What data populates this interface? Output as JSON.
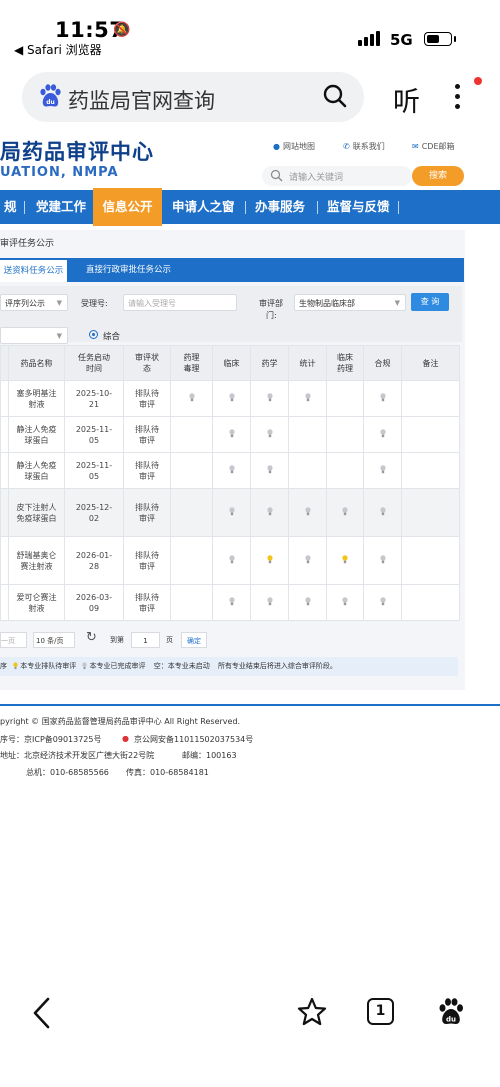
{
  "status_bar": {
    "time": "11:57",
    "back_app": "◀ Safari 浏览器",
    "network": "5G"
  },
  "browser": {
    "search_query": "药监局官网查询",
    "listen_label": "听"
  },
  "site": {
    "title": "局药品审评中心",
    "subtitle": "UATION, NMPA",
    "top_links": [
      "网站地图",
      "联系我们",
      "CDE邮箱"
    ],
    "search_placeholder": "请输入关键词",
    "search_button": "搜索"
  },
  "nav": {
    "items": [
      "规",
      "党建工作",
      "信息公开",
      "申请人之窗",
      "办事服务",
      "监督与反馈"
    ],
    "active": "信息公开"
  },
  "panel": {
    "title": "审评任务公示",
    "tabs": [
      "送资料任务公示",
      "直接行政审批任务公示"
    ],
    "filters": {
      "sequence_value": "评序列公示",
      "accept_no_label": "受理号:",
      "accept_no_placeholder": "请输入受理号",
      "dept_label_1": "审评部",
      "dept_label_2": "门:",
      "dept_value": "生物制品临床部",
      "query_button": "查 询",
      "radio_label": "综合"
    },
    "table": {
      "headers": [
        "药品名称",
        "任务启动时间",
        "审评状态",
        "药理毒理",
        "临床",
        "药学",
        "统计",
        "临床药理",
        "合规",
        "备注"
      ],
      "rows": [
        {
          "name": "塞多明基注射液",
          "date": "2025-10-21",
          "status": "排队待审评",
          "marks": [
            "done",
            "done",
            "done",
            "done",
            "",
            "done"
          ],
          "note": ""
        },
        {
          "name": "静注人免疫球蛋白",
          "date": "2025-11-05",
          "status": "排队待审评",
          "marks": [
            "",
            "done",
            "done",
            "",
            "",
            "done"
          ],
          "note": ""
        },
        {
          "name": "静注人免疫球蛋白",
          "date": "2025-11-05",
          "status": "排队待审评",
          "marks": [
            "",
            "done",
            "done",
            "",
            "",
            "done"
          ],
          "note": ""
        },
        {
          "name": "皮下注射人免疫球蛋白",
          "date": "2025-12-02",
          "status": "排队待审评",
          "marks": [
            "",
            "done",
            "done",
            "done",
            "done",
            "done"
          ],
          "note": ""
        },
        {
          "name": "舒瑞基奥仑赛注射液",
          "date": "2026-01-28",
          "status": "排队待审评",
          "marks": [
            "",
            "done",
            "pending",
            "done",
            "pending",
            "done"
          ],
          "note": ""
        },
        {
          "name": "爱可仑赛注射液",
          "date": "2026-03-09",
          "status": "排队待审评",
          "marks": [
            "",
            "done",
            "done",
            "done",
            "done",
            "done"
          ],
          "note": ""
        }
      ]
    },
    "pagination": {
      "prev": "一页",
      "page_size": "10 条/页",
      "goto_label": "到第",
      "page_value": "1",
      "page_unit": "页",
      "confirm": "确定"
    },
    "legend": {
      "prefix": "序",
      "pending": "本专业排队待审评",
      "done": "本专业已完成审评",
      "empty": "空：本专业未启动",
      "note": "所有专业结束后将进入综合审评阶段。"
    }
  },
  "footer": {
    "copyright": "pyright © 国家药品监督管理局药品审评中心   All Right Reserved.",
    "icp": "序号：京ICP备09013725号",
    "police": "京公网安备11011502037534号",
    "address": "地址：北京经济技术开发区广德大街22号院",
    "postcode": "邮编：100163",
    "phone": "总机：010-68585566",
    "fax": "传真：010-68584181"
  },
  "toolbar": {
    "tab_count": "1"
  },
  "colors": {
    "brand_blue": "#1e6fc7",
    "accent_orange": "#f39c27",
    "bulb_pending": "#f2c51d",
    "bulb_done": "#c4c7cc"
  }
}
